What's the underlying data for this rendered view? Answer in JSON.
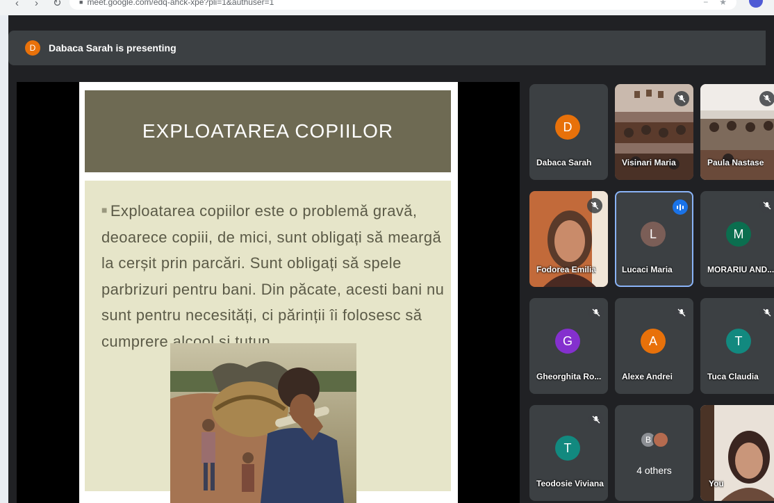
{
  "browser": {
    "url": "meet.google.com/edq-ahck-xpe?pli=1&authuser=1"
  },
  "presenting": {
    "avatar_initial": "D",
    "label": "Dabaca Sarah is presenting"
  },
  "slide": {
    "title": "EXPLOATAREA COPIILOR",
    "bullet": "Exploatarea copiilor este o problemă gravă, deoarece copiii, de mici, sunt obligați să meargă la cerșit prin parcări. Sunt obligați să spele parbrizuri pentru bani. Din păcate, acesti bani nu sunt pentru necesități, ci părinții îi folosesc să cumprere alcool și tutun."
  },
  "participants": [
    {
      "name": "Dabaca Sarah",
      "initial": "D",
      "color": "#e8710a",
      "muted": false,
      "kind": "avatar"
    },
    {
      "name": "Visinari Maria",
      "muted": true,
      "kind": "photo"
    },
    {
      "name": "Paula Nastase",
      "muted": true,
      "kind": "photo"
    },
    {
      "name": "Fodorea Emilia",
      "muted": true,
      "kind": "photo"
    },
    {
      "name": "Lucaci Maria",
      "initial": "L",
      "color": "#7b5e57",
      "muted": false,
      "speaking": true,
      "kind": "avatar"
    },
    {
      "name": "MORARIU AND...",
      "initial": "M",
      "color": "#0b6e4f",
      "muted": true,
      "kind": "avatar"
    },
    {
      "name": "Gheorghita Ro...",
      "initial": "G",
      "color": "#8430ce",
      "muted": true,
      "kind": "avatar"
    },
    {
      "name": "Alexe Andrei",
      "initial": "A",
      "color": "#e8710a",
      "muted": true,
      "kind": "avatar"
    },
    {
      "name": "Tuca Claudia",
      "initial": "T",
      "color": "#12897f",
      "muted": true,
      "kind": "avatar"
    },
    {
      "name": "Teodosie Viviana",
      "initial": "T",
      "color": "#12897f",
      "muted": true,
      "kind": "avatar"
    },
    {
      "others_label": "4 others",
      "others_initial": "B",
      "kind": "others"
    },
    {
      "name": "You",
      "muted": false,
      "kind": "photo"
    }
  ],
  "colors": {
    "meet_bg": "#202124",
    "tile_bg": "#3c4043",
    "speaking_blue": "#1a73e8",
    "slide_header": "#6e6a53",
    "slide_body": "#e6e5c9"
  }
}
